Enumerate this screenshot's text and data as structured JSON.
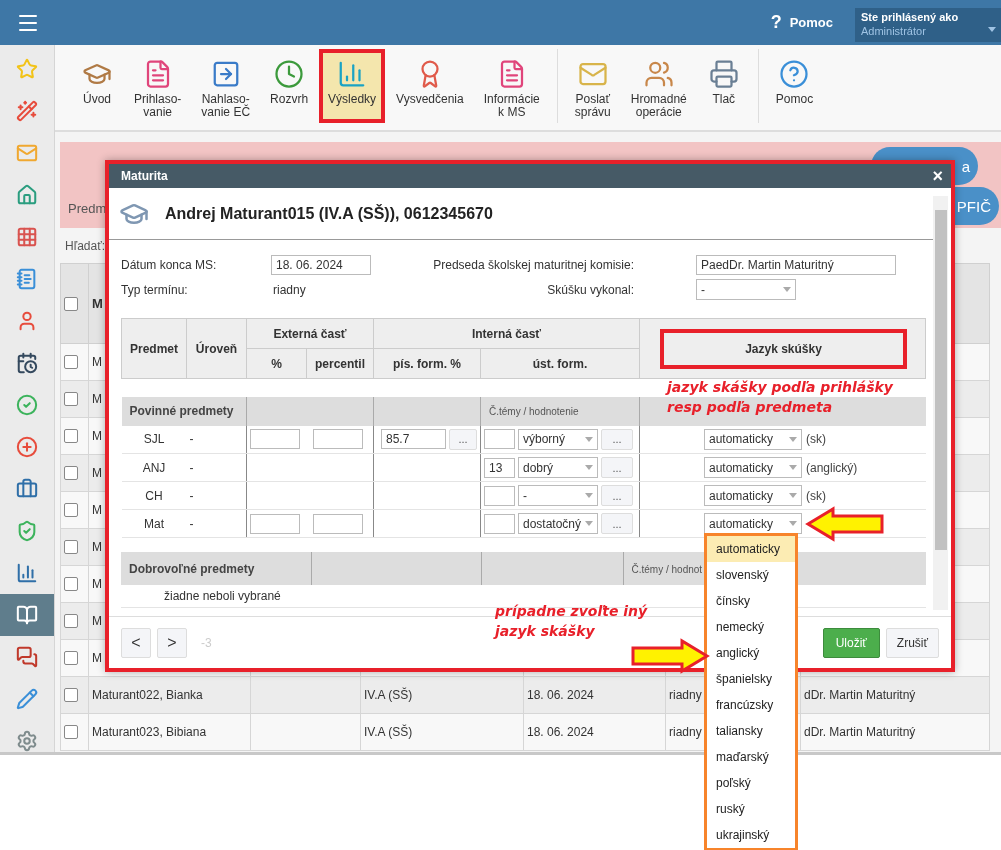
{
  "header": {
    "help_icon": "?",
    "help": "Pomoc",
    "user_label": "Ste prihlásený ako",
    "user_role": "Administrátor"
  },
  "sidebar": {
    "items": [
      {
        "kind": "star",
        "selected": false
      },
      {
        "kind": "wand",
        "selected": false
      },
      {
        "kind": "mail",
        "selected": false
      },
      {
        "kind": "home",
        "selected": false
      },
      {
        "kind": "grid",
        "selected": false
      },
      {
        "kind": "notebook",
        "selected": false
      },
      {
        "kind": "person",
        "selected": false
      },
      {
        "kind": "calendar",
        "selected": false
      },
      {
        "kind": "check",
        "selected": false
      },
      {
        "kind": "plus",
        "selected": false
      },
      {
        "kind": "briefcase",
        "selected": false
      },
      {
        "kind": "shield",
        "selected": false
      },
      {
        "kind": "chart",
        "selected": false
      },
      {
        "kind": "book",
        "selected": true
      },
      {
        "kind": "chat",
        "selected": false
      },
      {
        "kind": "pencil",
        "selected": false
      },
      {
        "kind": "gear",
        "selected": false
      }
    ]
  },
  "toolbar": {
    "groups": [
      {
        "items": [
          {
            "label": "Úvod",
            "kind": "graduates",
            "selected": false
          },
          {
            "label": "Prihlaso-\nvanie",
            "kind": "document",
            "selected": false
          },
          {
            "label": "Nahlaso-\nvanie EČ",
            "kind": "arrow",
            "selected": false
          },
          {
            "label": "Rozvrh",
            "kind": "clock",
            "selected": false
          },
          {
            "label": "Výsledky",
            "kind": "chart",
            "selected": true
          },
          {
            "label": "Vysvedčenia",
            "kind": "certificate",
            "selected": false
          },
          {
            "label": "Informácie\nk MS",
            "kind": "document",
            "selected": false
          }
        ]
      },
      {
        "items": [
          {
            "label": "Poslať\nsprávu",
            "kind": "envelope",
            "selected": false
          },
          {
            "label": "Hromadné\noperácie",
            "kind": "people",
            "selected": false
          },
          {
            "label": "Tlač",
            "kind": "printer",
            "selected": false
          }
        ]
      },
      {
        "items": [
          {
            "label": "Pomoc",
            "kind": "help",
            "selected": false
          }
        ]
      }
    ]
  },
  "banner": {
    "text": "Predm",
    "buttons": [
      "a",
      "PFIČ"
    ]
  },
  "search": {
    "label": "Hľadať:"
  },
  "table": {
    "header": "M",
    "header_checked": false,
    "rows": [
      {
        "name": "M",
        "checked": false
      },
      {
        "name": "M",
        "checked": false
      },
      {
        "name": "M",
        "checked": false
      },
      {
        "name": "M",
        "checked": false
      },
      {
        "name": "M",
        "checked": false
      },
      {
        "name": "M",
        "checked": false
      },
      {
        "name": "M",
        "checked": false
      },
      {
        "name": "M",
        "checked": false
      },
      {
        "name": "M",
        "checked": false
      },
      {
        "name": "Maturant022, Bianka",
        "checked": false,
        "column_3": "IV.A (SŠ)",
        "column_4": "18. 06. 2024",
        "column_5": "riadny",
        "column_6": "dDr. Martin Maturitný"
      },
      {
        "name": "Maturant023, Bibiana",
        "checked": false,
        "column_3": "IV.A (SŠ)",
        "column_4": "18. 06. 2024",
        "column_5": "riadny",
        "column_6": "dDr. Martin Maturitný"
      }
    ]
  },
  "modal": {
    "title": "Maturita",
    "close": "×",
    "heading": "Andrej Maturant015 (IV.A (SŠ)), 0612345670",
    "fields": {
      "end_date_label": "Dátum konca MS:",
      "end_date": "18. 06. 2024",
      "type_label": "Typ termínu:",
      "type": "riadny",
      "chair_label": "Predseda školskej maturitnej komisie:",
      "chair": "PaedDr. Martin Maturitný",
      "completed_label": "Skúšku vykonal:",
      "completed": "-"
    },
    "columns": {
      "subject": "Predmet",
      "level": "Úroveň",
      "external": "Externá časť",
      "external_pct": "%",
      "percentile": "percentil",
      "internal": "Interná časť",
      "written": "pís. form. %",
      "oral": "úst. form.",
      "language": "Jazyk skúšky"
    },
    "mandatory": {
      "title": "Povinné predmety",
      "oral_hint": "Č.témy / hodnotenie",
      "rows": [
        {
          "subject": "SJL",
          "level": "-",
          "has_external": true,
          "written": "85.7",
          "written_action": "...",
          "grade": "výborný",
          "oral_action": "...",
          "language": "automaticky",
          "language_note": "(sk)",
          "open": false
        },
        {
          "subject": "ANJ",
          "level": "-",
          "has_external": false,
          "topic": "13",
          "grade": "dobrý",
          "oral_action": "...",
          "language": "automaticky",
          "language_note": "(anglický)",
          "open": false
        },
        {
          "subject": "CH",
          "level": "-",
          "has_external": false,
          "grade": "-",
          "oral_action": "...",
          "language": "automaticky",
          "language_note": "(sk)",
          "open": false
        },
        {
          "subject": "Mat",
          "level": "-",
          "has_external": true,
          "grade": "dostatočný",
          "oral_action": "...",
          "language": "automaticky",
          "open": true
        }
      ]
    },
    "optional": {
      "title": "Dobrovoľné predmety",
      "oral_hint": "Č.témy / hodnot",
      "empty": "žiadne neboli vybrané"
    },
    "language_options": [
      {
        "label": "automaticky",
        "selected": true
      },
      {
        "label": "slovenský",
        "selected": false
      },
      {
        "label": "čínsky",
        "selected": false
      },
      {
        "label": "nemecký",
        "selected": false
      },
      {
        "label": "anglický",
        "selected": false
      },
      {
        "label": "španielsky",
        "selected": false
      },
      {
        "label": "francúzsky",
        "selected": false
      },
      {
        "label": "taliansky",
        "selected": false
      },
      {
        "label": "maďarský",
        "selected": false
      },
      {
        "label": "poľský",
        "selected": false
      },
      {
        "label": "ruský",
        "selected": false
      },
      {
        "label": "ukrajinský",
        "selected": false
      }
    ],
    "footer": {
      "prev": "<",
      "next": ">",
      "counter": "-3",
      "save": "Uložiť",
      "cancel": "Zrušiť"
    }
  },
  "notes": {
    "top": [
      "jazyk skášky podľa prihlášky",
      "resp podľa predmeta"
    ],
    "bottom": [
      "prípadne zvoľte iný",
      "jazyk skášky"
    ]
  }
}
